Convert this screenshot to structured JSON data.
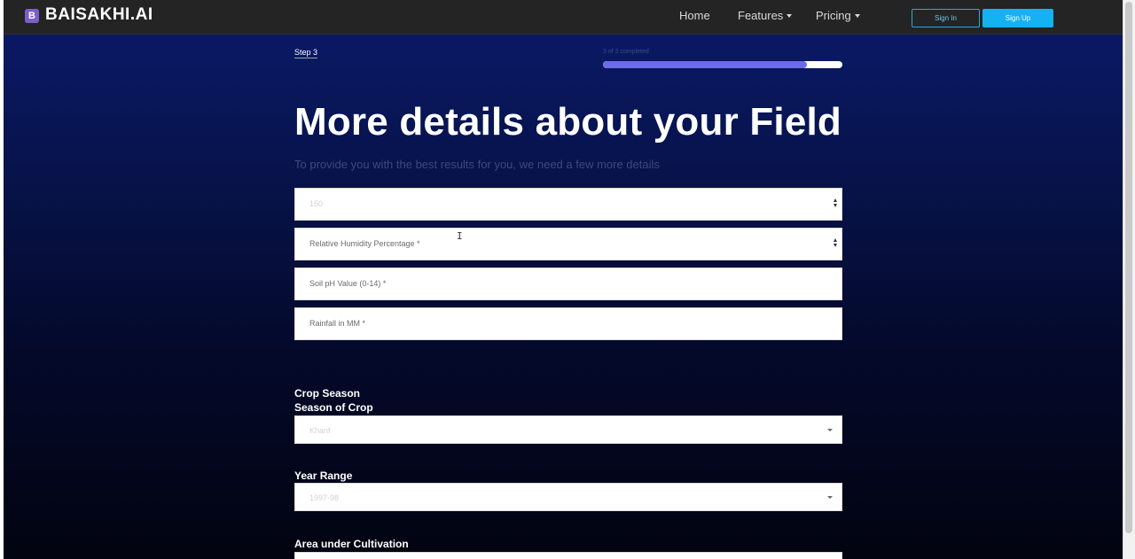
{
  "brand": {
    "icon_letter": "B",
    "name": "BAISAKHI.AI"
  },
  "nav": {
    "home": "Home",
    "features": "Features",
    "pricing": "Pricing",
    "sign_in": "Sign In",
    "sign_up": "Sign Up"
  },
  "progress": {
    "step": "Step 3",
    "text": "3 of 3 completed",
    "fraction": 0.85
  },
  "title": "More details about your Field",
  "subtitle": "To provide you with the best results for you, we need a few more details",
  "fields": [
    {
      "value": "150",
      "placeholder": ""
    },
    {
      "placeholder": "Relative Humidity Percentage *"
    },
    {
      "placeholder": "Soil pH Value (0-14) *"
    },
    {
      "placeholder": "Rainfall in MM *"
    }
  ],
  "crop_season": {
    "heading": "Crop Season",
    "label": "Season of Crop",
    "selected": "Kharif"
  },
  "year_range": {
    "label": "Year Range",
    "selected": "1997-98"
  },
  "area": {
    "label": "Area under Cultivation"
  },
  "colors": {
    "accent": "#14b2f0",
    "progress": "#6c6ce8",
    "brand_icon": "#7b5fc7"
  }
}
